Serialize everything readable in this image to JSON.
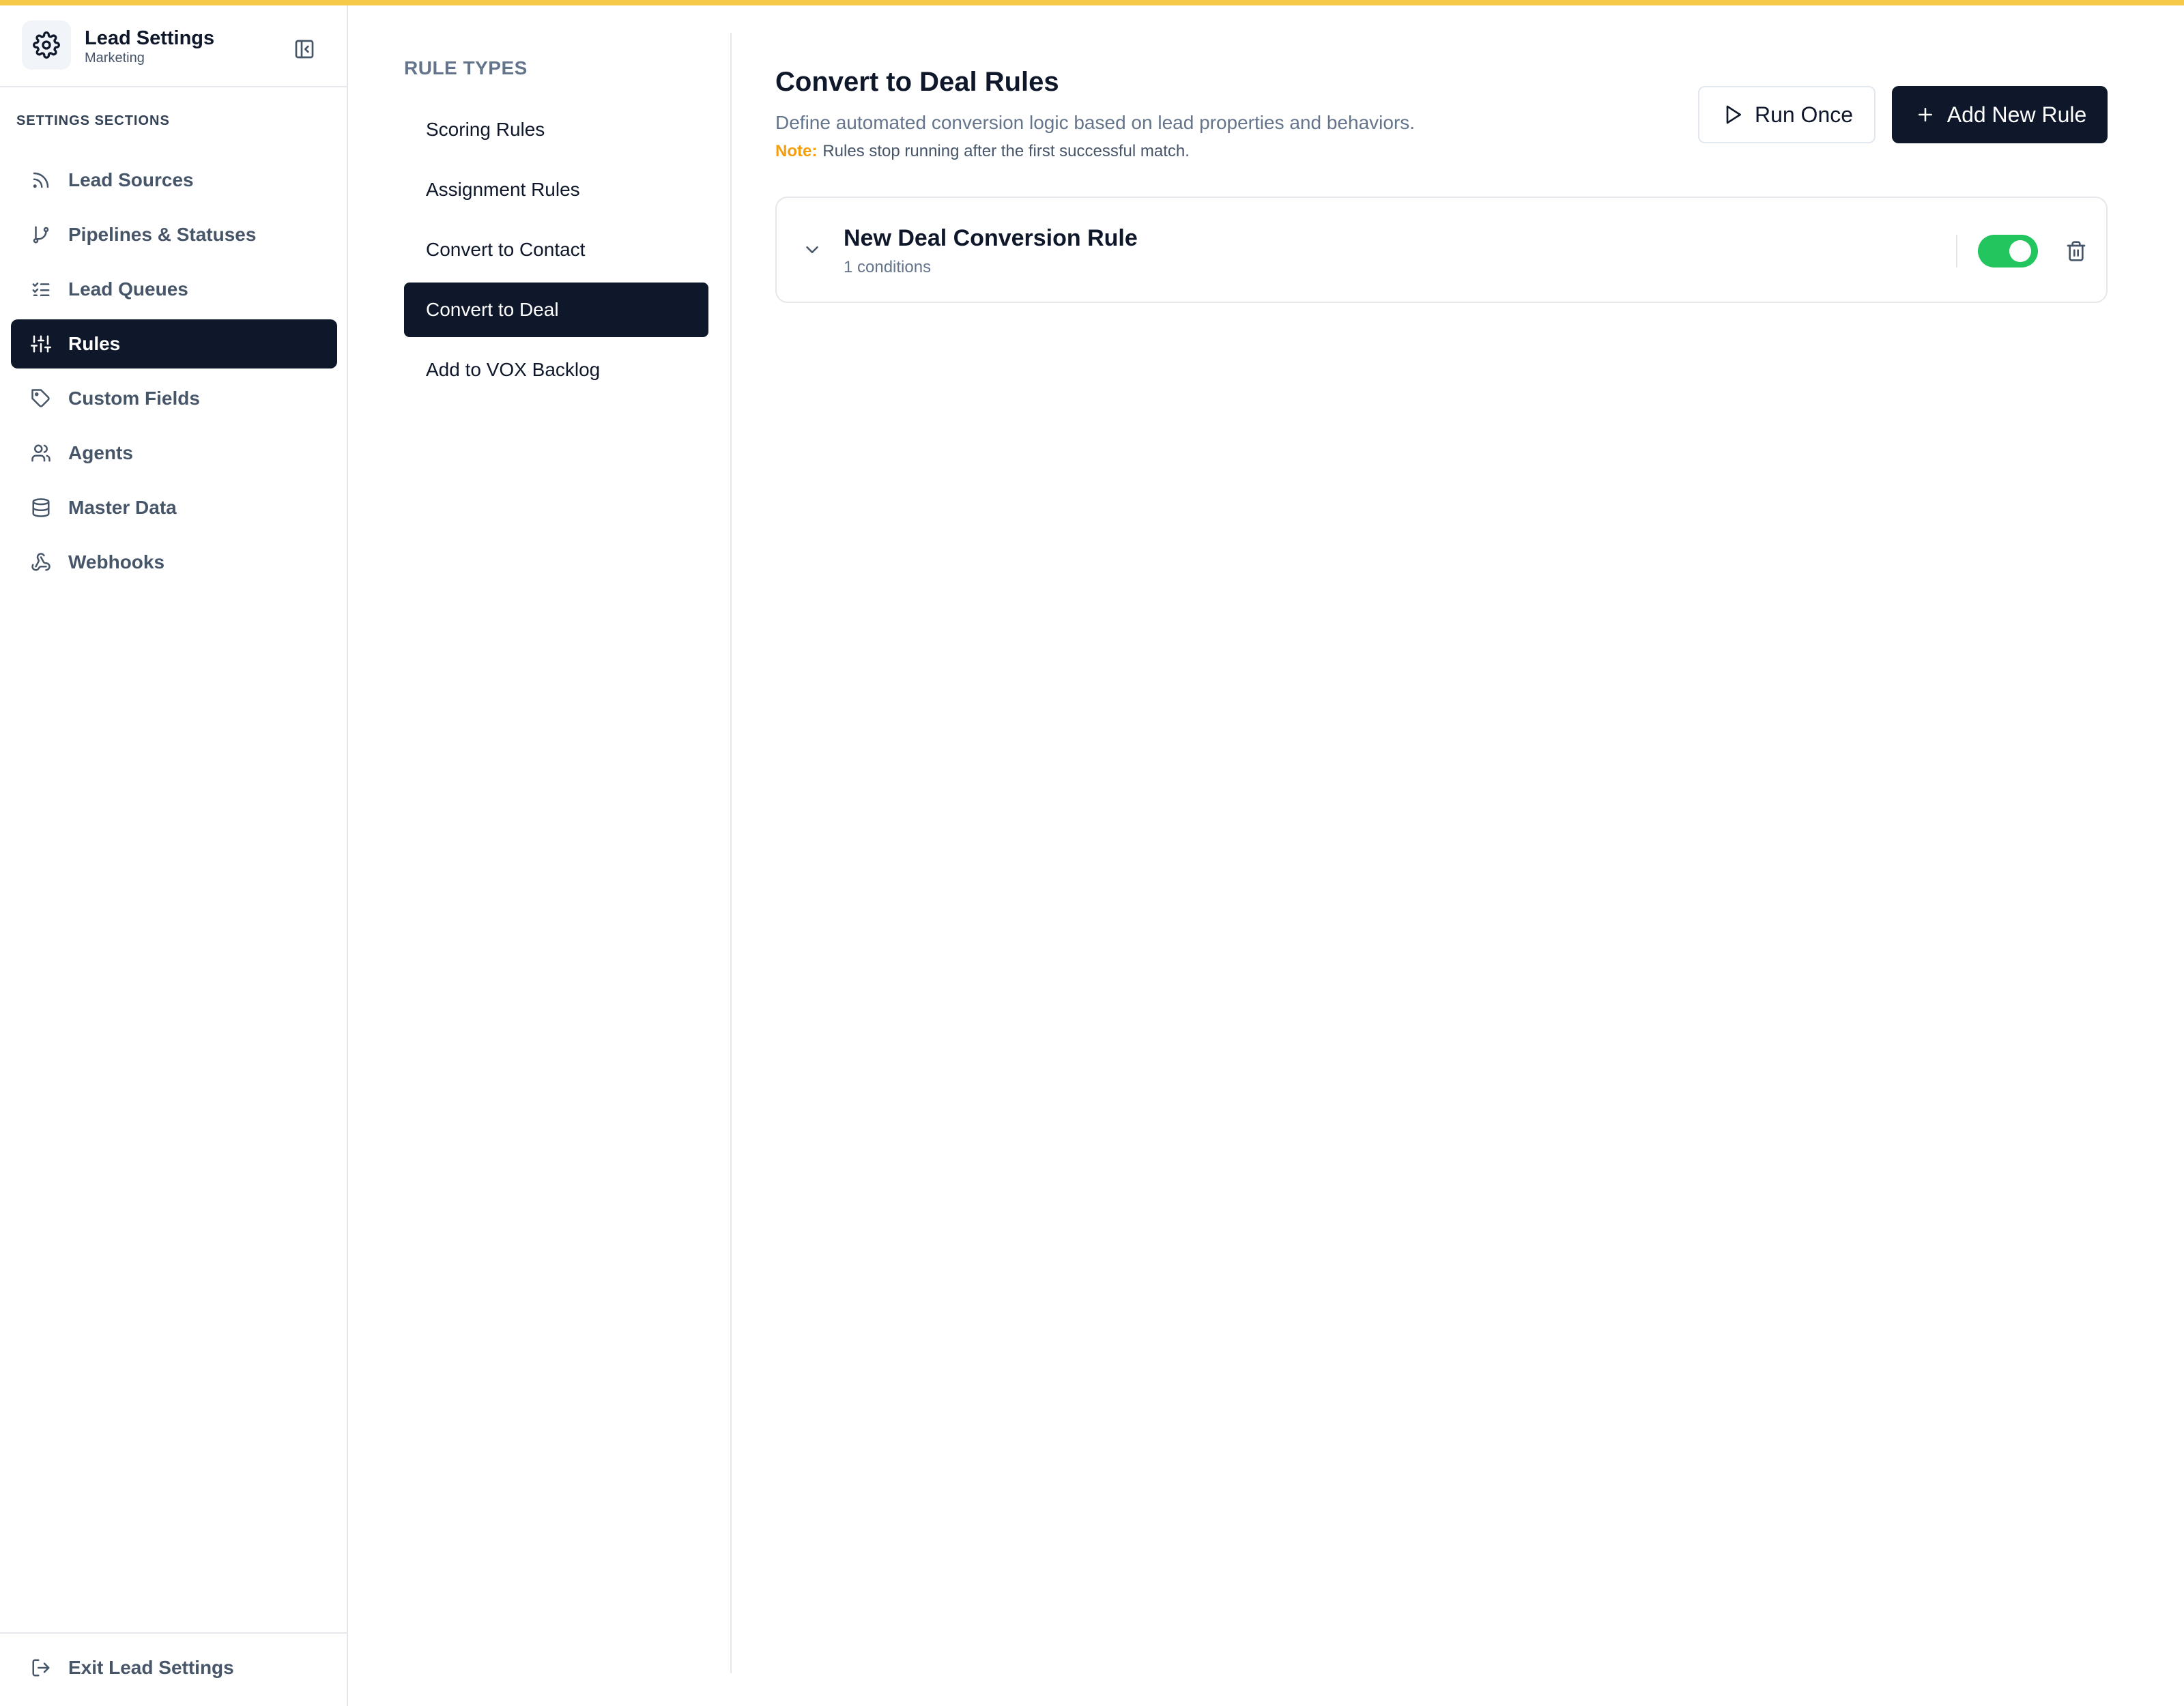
{
  "sidebar": {
    "title": "Lead Settings",
    "subtitle": "Marketing",
    "section_label": "SETTINGS SECTIONS",
    "items": [
      {
        "label": "Lead Sources",
        "icon": "rss-icon"
      },
      {
        "label": "Pipelines & Statuses",
        "icon": "git-branch-icon"
      },
      {
        "label": "Lead Queues",
        "icon": "list-checks-icon"
      },
      {
        "label": "Rules",
        "icon": "sliders-icon",
        "active": true
      },
      {
        "label": "Custom Fields",
        "icon": "tag-icon"
      },
      {
        "label": "Agents",
        "icon": "users-icon"
      },
      {
        "label": "Master Data",
        "icon": "database-icon"
      },
      {
        "label": "Webhooks",
        "icon": "webhook-icon"
      }
    ],
    "exit_label": "Exit Lead Settings"
  },
  "rule_types": {
    "label": "RULE TYPES",
    "items": [
      {
        "label": "Scoring Rules"
      },
      {
        "label": "Assignment Rules"
      },
      {
        "label": "Convert to Contact"
      },
      {
        "label": "Convert to Deal",
        "active": true
      },
      {
        "label": "Add to VOX Backlog"
      }
    ]
  },
  "main": {
    "title": "Convert to Deal Rules",
    "description": "Define automated conversion logic based on lead properties and behaviors.",
    "note_label": "Note:",
    "note_text": "Rules stop running after the first successful match.",
    "run_once_label": "Run Once",
    "add_rule_label": "Add New Rule",
    "rules": [
      {
        "name": "New Deal Conversion Rule",
        "conditions": "1 conditions",
        "enabled": true
      }
    ]
  },
  "colors": {
    "accent_top": "#f7c948",
    "active_bg": "#0f172a",
    "toggle_on": "#22c55e",
    "note": "#f59e0b"
  }
}
